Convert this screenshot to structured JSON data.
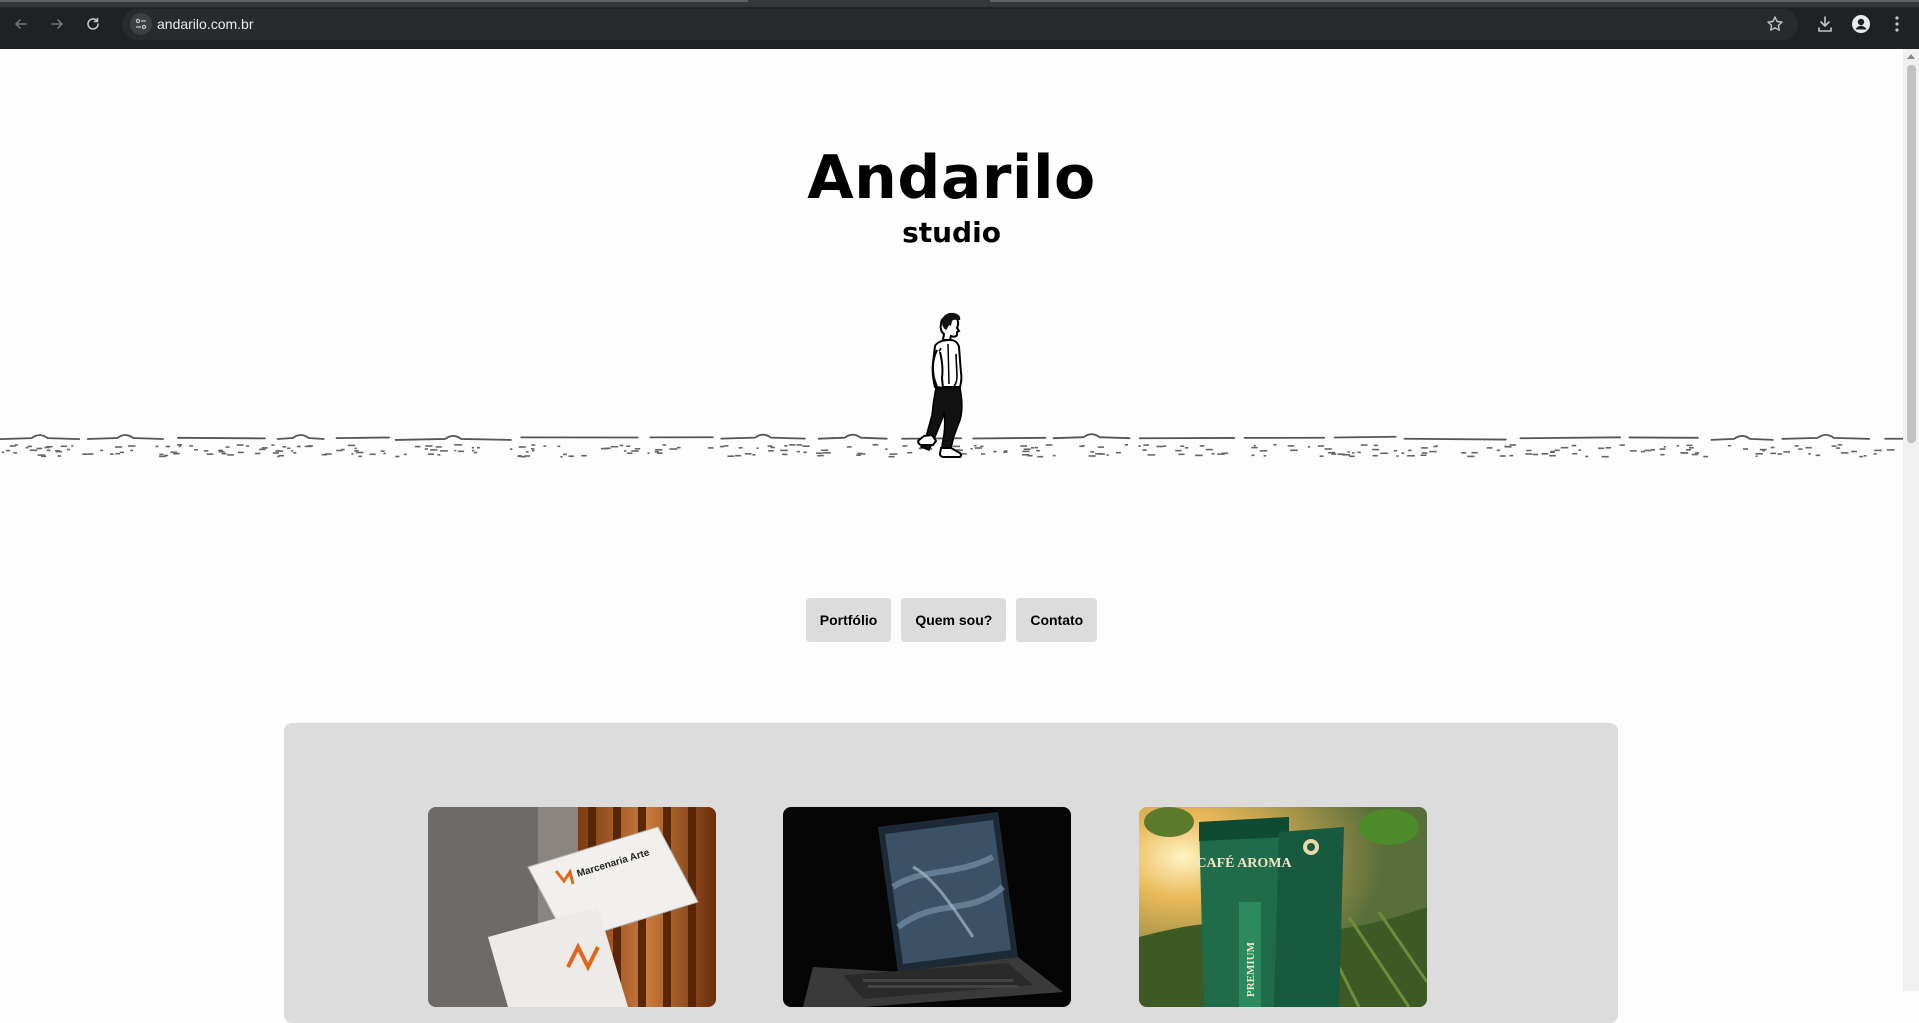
{
  "browser": {
    "url": "andarilo.com.br",
    "icons": [
      "back-arrow-icon",
      "forward-arrow-icon",
      "reload-icon",
      "site-settings-icon",
      "bookmark-star-icon",
      "download-icon",
      "profile-icon",
      "menu-dots-icon"
    ]
  },
  "hero": {
    "title": "Andarilo",
    "subtitle": "studio"
  },
  "nav": {
    "portfolio": "Portfólio",
    "about": "Quem sou?",
    "contact": "Contato"
  },
  "portfolio": {
    "cards": [
      {
        "image_text": "Marcenaria Arte"
      },
      {
        "image_text": ""
      },
      {
        "image_text_top": "CAFÉ AROMA",
        "image_text_side": "PREMIUM"
      }
    ]
  }
}
